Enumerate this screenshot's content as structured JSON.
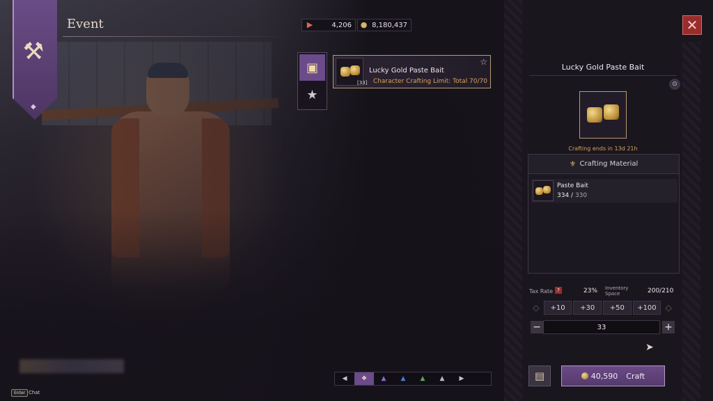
{
  "header": {
    "title": "Event"
  },
  "currencies": [
    {
      "icon": "ticket-icon",
      "value": "4,206"
    },
    {
      "icon": "silver-coin-icon",
      "value": "8,180,437"
    }
  ],
  "categories": [
    {
      "icon": "cube-icon",
      "active": true
    },
    {
      "icon": "star-icon",
      "active": false
    }
  ],
  "item": {
    "name": "Lucky Gold Paste Bait",
    "count": "[33]",
    "limit": "Character Crafting Limit: Total 70/70"
  },
  "detail": {
    "title": "Lucky Gold Paste Bait",
    "crafting_ends": "Crafting ends in 13d 21h",
    "materials_header": "Crafting Material",
    "materials": [
      {
        "name": "Paste Bait",
        "have": "334",
        "sep": " / ",
        "need": "330"
      }
    ],
    "tax_label": "Tax Rate",
    "tax_value": "23%",
    "inventory_label": "Inventory Space",
    "inventory_value": "200/210",
    "quick_add": [
      "+10",
      "+30",
      "+50",
      "+100"
    ],
    "quantity": "33",
    "craft_cost": "40,590",
    "craft_label": "Craft"
  },
  "chat": {
    "key": "Enter",
    "label": "Chat"
  },
  "colors": {
    "accent": "#6b4b8a",
    "gold": "#d9a45d",
    "close": "#9a2c2c"
  }
}
